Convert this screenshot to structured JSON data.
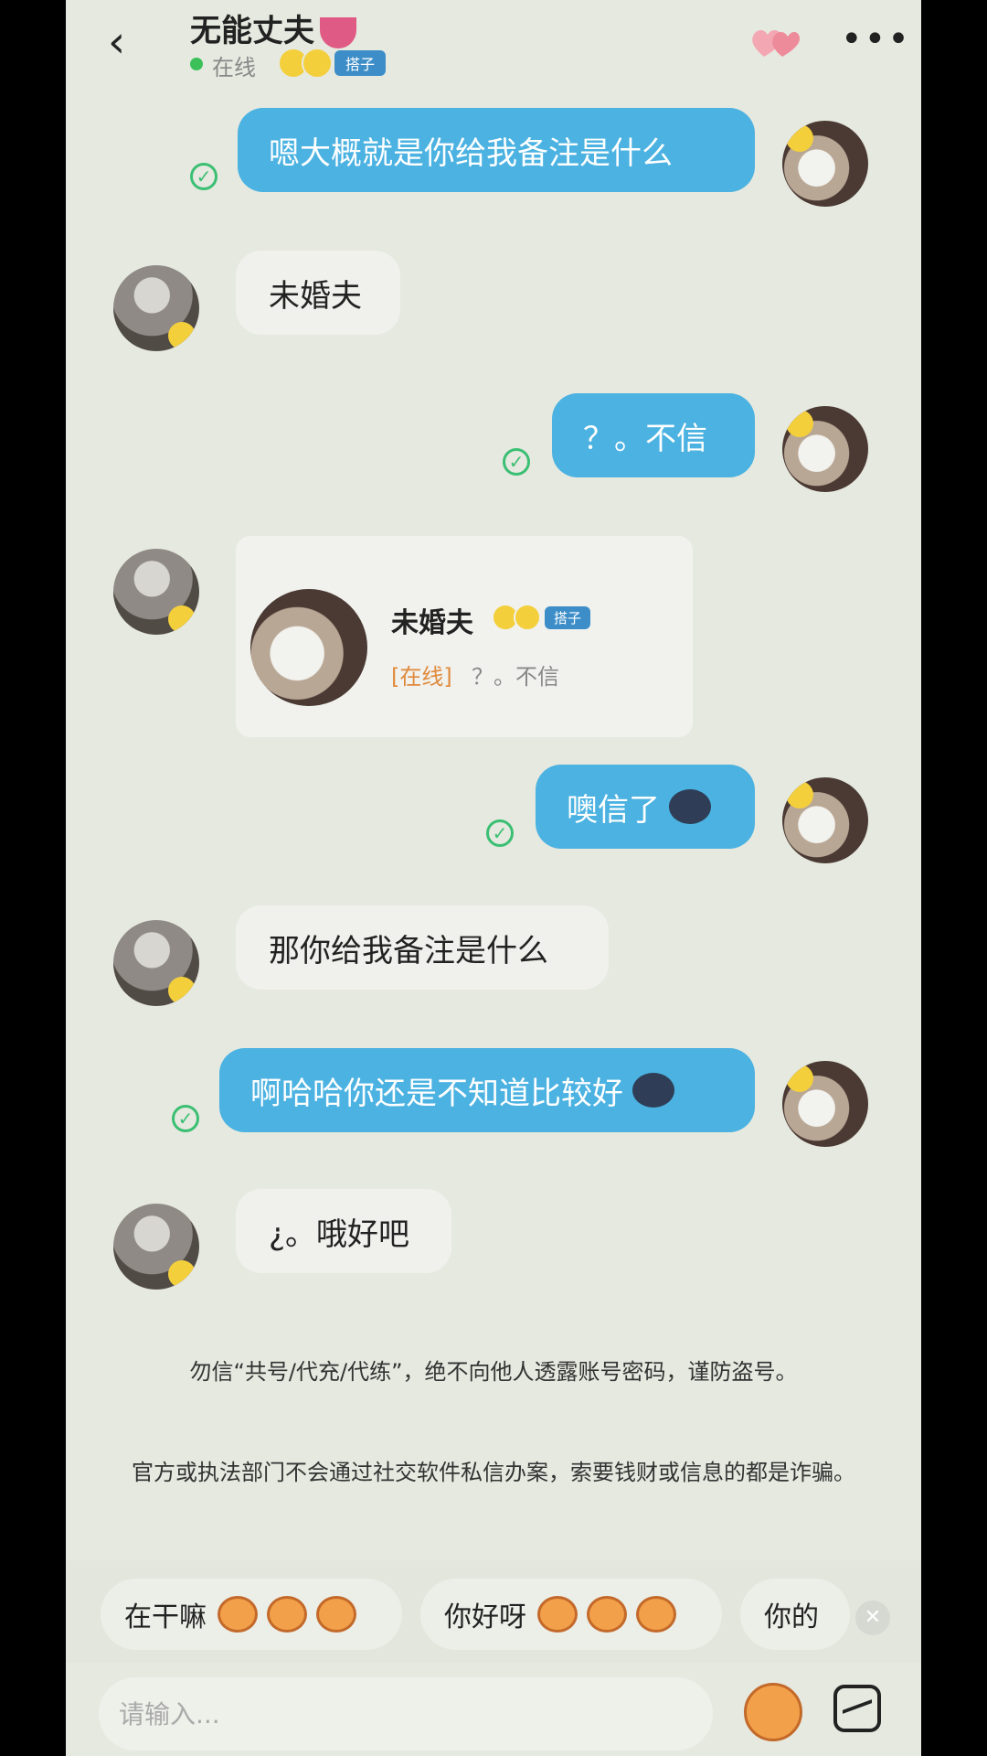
{
  "header": {
    "back_label": "‹",
    "title": "无能丈夫",
    "status": "在线",
    "badge": "搭子",
    "more_label": "•••"
  },
  "messages": [
    {
      "from": "me",
      "text": "嗯大概就是你给我备注是什么"
    },
    {
      "from": "other",
      "text": "未婚夫"
    },
    {
      "from": "me",
      "text": "？。不信"
    },
    {
      "from": "other",
      "type": "card",
      "name": "未婚夫",
      "badge": "搭子",
      "status": "[在线]",
      "preview": "？。不信"
    },
    {
      "from": "me",
      "text": "噢信了"
    },
    {
      "from": "other",
      "text": "那你给我备注是什么"
    },
    {
      "from": "me",
      "text": "啊哈哈你还是不知道比较好"
    },
    {
      "from": "other",
      "text": "¿。哦好吧"
    }
  ],
  "notices": [
    "勿信“共号/代充/代练”，绝不向他人透露账号密码，谨防盗号。",
    "官方或执法部门不会通过社交软件私信办案，索要钱财或信息的都是诈骗。"
  ],
  "quick_replies": [
    "在干嘛",
    "你好呀",
    "你的"
  ],
  "input": {
    "placeholder": "请输入..."
  },
  "colors": {
    "bubble_out": "#4bb2e1",
    "bubble_in": "#f0f1ec",
    "background": "#e6e9e0",
    "online": "#3cc15a",
    "check": "#3bbf73"
  }
}
